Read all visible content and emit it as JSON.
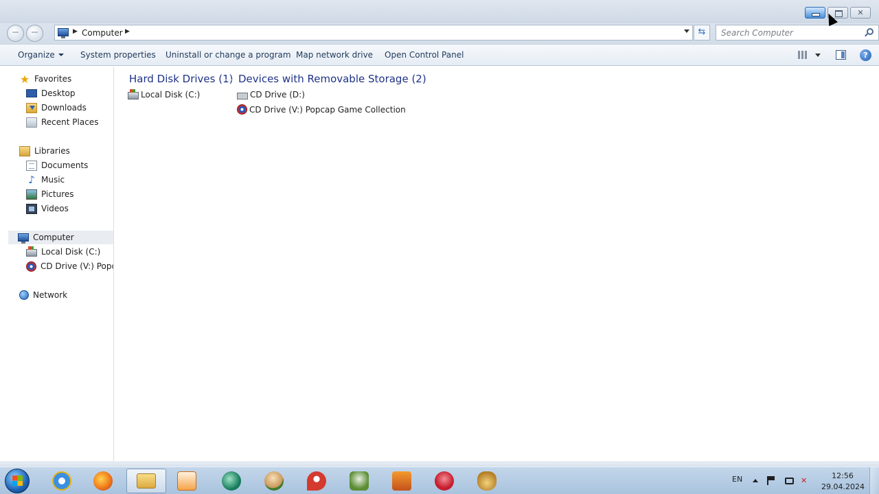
{
  "window": {
    "minimize_tooltip_icon": "minimize-icon",
    "maximize_icon": "maximize-icon",
    "close_glyph": "✕"
  },
  "address": {
    "location": "Computer",
    "search_placeholder": "Search Computer",
    "refresh_glyph": "⇆"
  },
  "toolbar": {
    "organize": "Organize",
    "system_properties": "System properties",
    "uninstall": "Uninstall or change a program",
    "map_drive": "Map network drive",
    "control_panel": "Open Control Panel",
    "help_glyph": "?"
  },
  "nav": {
    "favorites": "Favorites",
    "desktop": "Desktop",
    "downloads": "Downloads",
    "recent": "Recent Places",
    "libraries": "Libraries",
    "documents": "Documents",
    "music": "Music",
    "pictures": "Pictures",
    "videos": "Videos",
    "computer": "Computer",
    "local_disk": "Local Disk (C:)",
    "cd_drive_v": "CD Drive (V:) Popcap Game Collection",
    "network": "Network"
  },
  "groups": {
    "hard_disks": {
      "title": "Hard Disk Drives (1)",
      "items": [
        "Local Disk (C:)"
      ]
    },
    "removable": {
      "title": "Devices with Removable Storage (2)",
      "items": [
        "CD Drive (D:)",
        "CD Drive (V:) Popcap Game Collection"
      ]
    }
  },
  "taskbar": {
    "apps": [
      "internet-explorer",
      "firefox",
      "windows-explorer",
      "media-player",
      "zuma",
      "baldi",
      "popcap-launcher",
      "plants-vs-zombies",
      "game-orange",
      "game-question",
      "money-bag"
    ],
    "language": "EN",
    "time": "12:56",
    "date": "29.04.2024",
    "volume_glyph": "✕"
  },
  "colors": {
    "group_title": "#1e3287",
    "command_text": "#1e395b",
    "accent_blue": "#2a6fc9"
  }
}
